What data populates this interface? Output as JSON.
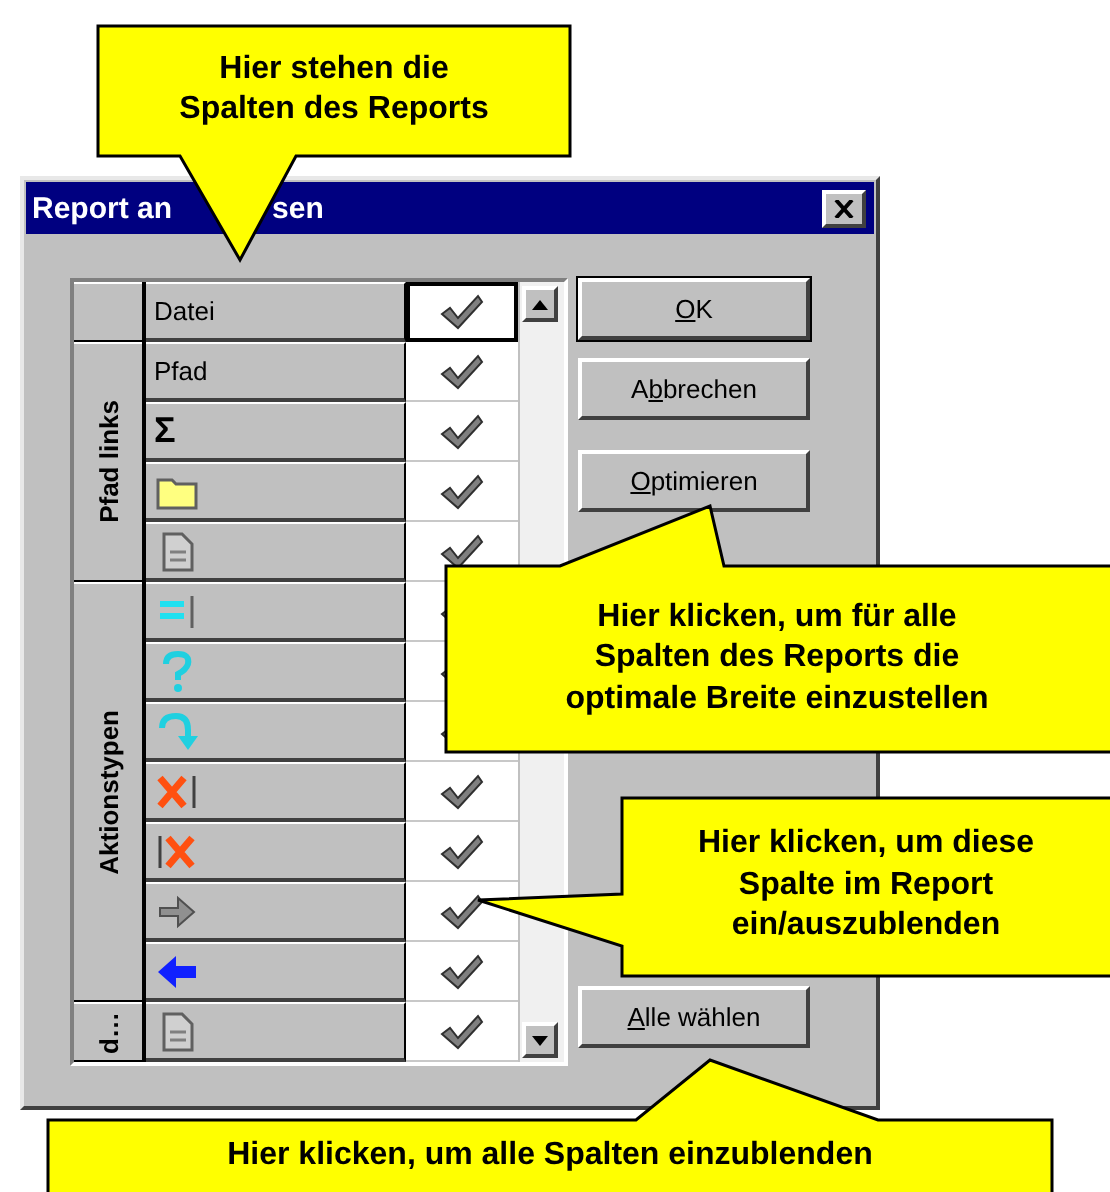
{
  "window": {
    "title_parts": [
      "Report an",
      "sen"
    ]
  },
  "groups": [
    {
      "rows": [
        {
          "kind": "text",
          "label": "Datei",
          "checked": true,
          "selected": true
        }
      ]
    },
    {
      "label": "Pfad links",
      "rows": [
        {
          "kind": "text",
          "label": "Pfad",
          "checked": true,
          "selected": false
        },
        {
          "kind": "text",
          "label": "Σ",
          "checked": true,
          "selected": false
        },
        {
          "kind": "folder",
          "checked": true,
          "selected": false
        },
        {
          "kind": "document",
          "checked": true,
          "selected": false
        }
      ]
    },
    {
      "label": "Aktionstypen",
      "rows": [
        {
          "kind": "equals",
          "checked": true,
          "selected": false
        },
        {
          "kind": "question",
          "checked": true,
          "selected": false
        },
        {
          "kind": "redo",
          "checked": true,
          "selected": false
        },
        {
          "kind": "deleteright",
          "checked": true,
          "selected": false
        },
        {
          "kind": "deleteleft",
          "checked": true,
          "selected": false
        },
        {
          "kind": "forward",
          "checked": true,
          "selected": false
        },
        {
          "kind": "back",
          "checked": true,
          "selected": false
        }
      ]
    },
    {
      "label": "d…",
      "rows": [
        {
          "kind": "document",
          "checked": true,
          "selected": false
        }
      ]
    }
  ],
  "buttons": [
    {
      "key": "O",
      "after": "K",
      "default": true
    },
    {
      "before": "A",
      "key": "b",
      "after": "brechen",
      "default": false
    },
    {
      "key": "O",
      "after": "ptimieren",
      "default": false
    },
    {
      "key": "A",
      "after": "lle wählen",
      "default": false
    }
  ],
  "callouts": [
    "Hier stehen die\nSpalten des Reports",
    "Hier klicken, um für alle\nSpalten des Reports die\noptimale Breite einzustellen",
    "Hier klicken, um diese\nSpalte im Report\nein/auszublenden",
    "Hier klicken, um alle Spalten einzublenden"
  ]
}
